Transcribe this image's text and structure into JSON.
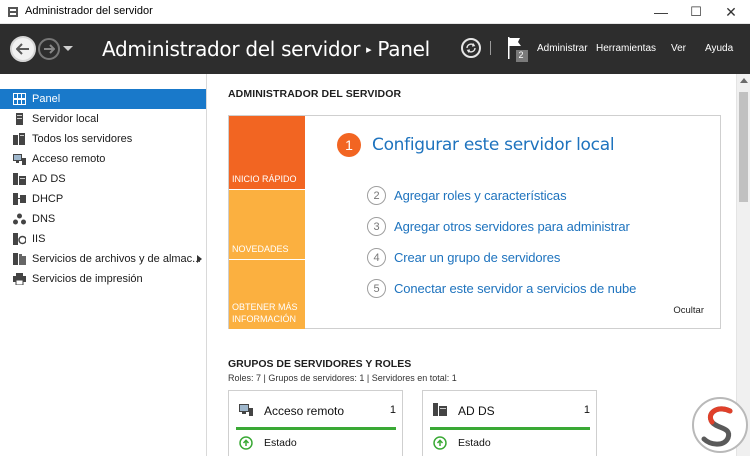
{
  "window": {
    "title": "Administrador del servidor",
    "controls": {
      "minimize": "—",
      "maximize": "☐",
      "close": "✕"
    }
  },
  "header": {
    "breadcrumb_root": "Administrador del servidor",
    "breadcrumb_separator": "▸",
    "breadcrumb_current": "Panel",
    "notification_count": "2",
    "menus": [
      "Administrar",
      "Herramientas",
      "Ver",
      "Ayuda"
    ]
  },
  "sidebar": {
    "items": [
      {
        "label": "Panel",
        "icon": "dashboard-icon",
        "active": true
      },
      {
        "label": "Servidor local",
        "icon": "server-icon"
      },
      {
        "label": "Todos los servidores",
        "icon": "servers-icon"
      },
      {
        "label": "Acceso remoto",
        "icon": "remote-access-icon"
      },
      {
        "label": "AD DS",
        "icon": "ad-ds-icon"
      },
      {
        "label": "DHCP",
        "icon": "dhcp-icon"
      },
      {
        "label": "DNS",
        "icon": "dns-icon"
      },
      {
        "label": "IIS",
        "icon": "iis-icon"
      },
      {
        "label": "Servicios de archivos y de almac...",
        "icon": "file-services-icon",
        "expandable": true
      },
      {
        "label": "Servicios de impresión",
        "icon": "printer-icon"
      }
    ]
  },
  "main": {
    "section_title": "ADMINISTRADOR DEL SERVIDOR",
    "quick_start": {
      "tiles": [
        {
          "label": "INICIO RÁPIDO",
          "color": "#f26522"
        },
        {
          "label": "NOVEDADES",
          "color": "#fbb040"
        },
        {
          "label": "OBTENER MÁS INFORMACIÓN",
          "color": "#fbb040"
        }
      ],
      "primary_step": {
        "number": "1",
        "text": "Configurar este servidor local"
      },
      "steps": [
        {
          "number": "2",
          "text": "Agregar roles y características"
        },
        {
          "number": "3",
          "text": "Agregar otros servidores para administrar"
        },
        {
          "number": "4",
          "text": "Crear un grupo de servidores"
        },
        {
          "number": "5",
          "text": "Conectar este servidor a servicios de nube"
        }
      ],
      "hide_label": "Ocultar"
    },
    "groups": {
      "title": "GRUPOS DE SERVIDORES Y ROLES",
      "summary": "Roles: 7   |   Grupos de servidores: 1   |   Servidores en total: 1",
      "cards": [
        {
          "name": "Acceso remoto",
          "count": "1",
          "status": "Estado",
          "icon": "remote-access-icon",
          "status_color": "#3aa935"
        },
        {
          "name": "AD DS",
          "count": "1",
          "status": "Estado",
          "icon": "ad-ds-icon",
          "status_color": "#3aa935"
        }
      ]
    }
  },
  "colors": {
    "header_bg": "#2d2d2d",
    "accent_blue": "#1979ca",
    "link_blue": "#1e73be",
    "orange": "#f26522",
    "yellow": "#fbb040",
    "status_green": "#3aa935"
  }
}
